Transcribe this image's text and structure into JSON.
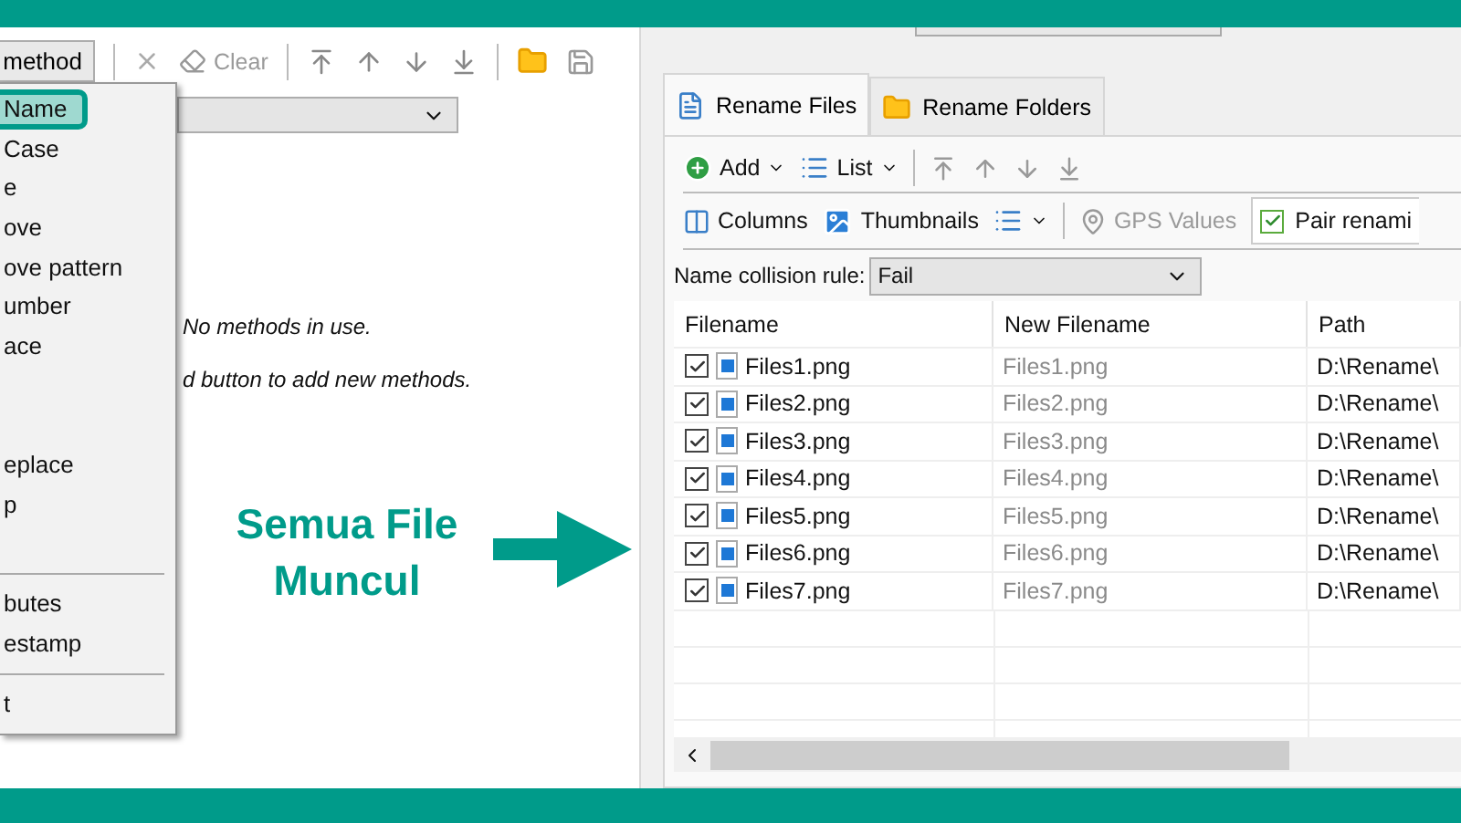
{
  "methods_toolbar": {
    "add_button": "method",
    "clear_button": "Clear"
  },
  "method_menu": {
    "items": [
      {
        "kind": "item",
        "label": "Name",
        "selected": true
      },
      {
        "kind": "item",
        "label": "Case",
        "selected": false
      },
      {
        "kind": "item",
        "label": "e",
        "selected": false
      },
      {
        "kind": "item",
        "label": "ove",
        "selected": false
      },
      {
        "kind": "item",
        "label": "ove pattern",
        "selected": false
      },
      {
        "kind": "item",
        "label": "umber",
        "selected": false
      },
      {
        "kind": "item",
        "label": "ace",
        "selected": false
      },
      {
        "kind": "blank"
      },
      {
        "kind": "blank"
      },
      {
        "kind": "item",
        "label": "eplace",
        "selected": false
      },
      {
        "kind": "item",
        "label": "p",
        "selected": false
      },
      {
        "kind": "blank"
      },
      {
        "kind": "separator"
      },
      {
        "kind": "item",
        "label": "butes",
        "selected": false
      },
      {
        "kind": "item",
        "label": "estamp",
        "selected": false
      },
      {
        "kind": "separator"
      },
      {
        "kind": "item",
        "label": "t",
        "selected": false
      }
    ]
  },
  "method_list": {
    "messages": [
      "No methods in use.",
      "d button to add new methods."
    ]
  },
  "annotation": {
    "text": "Semua File Muncul"
  },
  "tabs": [
    {
      "label": "Rename Files",
      "kind": "file",
      "selected": true
    },
    {
      "label": "Rename Folders",
      "kind": "folder",
      "selected": false
    }
  ],
  "files_toolbar": {
    "add_button": "Add",
    "list_button": "List"
  },
  "view_toolbar": [
    {
      "kind": "columns",
      "label": "Columns",
      "disabled": false
    },
    {
      "kind": "thumbnails",
      "label": "Thumbnails",
      "disabled": false
    },
    {
      "kind": "gps",
      "label": "GPS Values",
      "disabled": true
    },
    {
      "kind": "pair",
      "label": "Pair renami",
      "checked": true,
      "disabled": false
    }
  ],
  "collision": {
    "label": "Name collision rule:",
    "value": "Fail"
  },
  "table": {
    "columns": [
      "Filename",
      "New Filename",
      "Path"
    ],
    "rows": [
      {
        "checked": true,
        "filename": "Files1.png",
        "new_filename": "Files1.png",
        "path": "D:\\Rename\\"
      },
      {
        "checked": true,
        "filename": "Files2.png",
        "new_filename": "Files2.png",
        "path": "D:\\Rename\\"
      },
      {
        "checked": true,
        "filename": "Files3.png",
        "new_filename": "Files3.png",
        "path": "D:\\Rename\\"
      },
      {
        "checked": true,
        "filename": "Files4.png",
        "new_filename": "Files4.png",
        "path": "D:\\Rename\\"
      },
      {
        "checked": true,
        "filename": "Files5.png",
        "new_filename": "Files5.png",
        "path": "D:\\Rename\\"
      },
      {
        "checked": true,
        "filename": "Files6.png",
        "new_filename": "Files6.png",
        "path": "D:\\Rename\\"
      },
      {
        "checked": true,
        "filename": "Files7.png",
        "new_filename": "Files7.png",
        "path": "D:\\Rename\\"
      }
    ]
  }
}
